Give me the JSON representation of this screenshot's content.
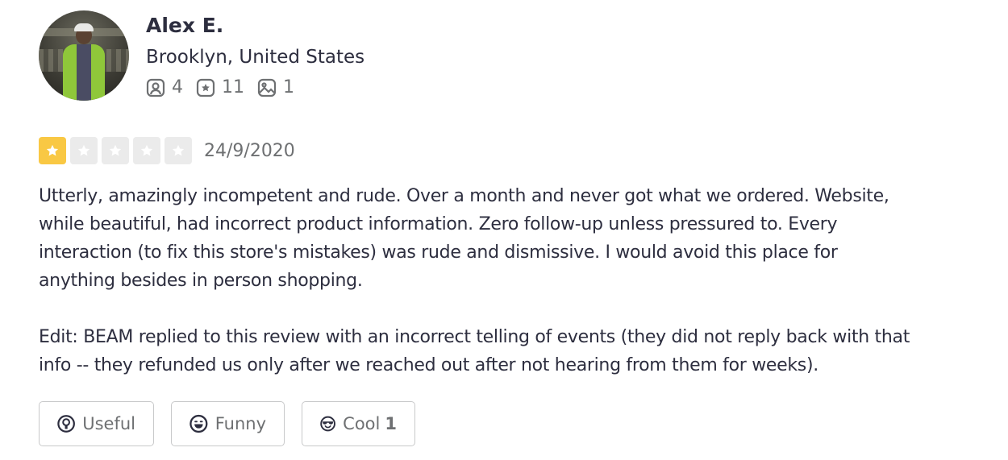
{
  "user": {
    "name": "Alex E.",
    "location": "Brooklyn, United States",
    "stats": [
      {
        "icon": "friends-icon",
        "value": "4"
      },
      {
        "icon": "reviews-star-icon",
        "value": "11"
      },
      {
        "icon": "photos-icon",
        "value": "1"
      }
    ]
  },
  "review": {
    "rating": 1,
    "max_rating": 5,
    "star_color_on": "#f9c844",
    "star_color_off": "#ebebeb",
    "date": "24/9/2020",
    "paragraphs": [
      "Utterly, amazingly incompetent and rude. Over a month and never got what we ordered. Website,\nwhile beautiful, had incorrect product information. Zero follow-up unless pressured to. Every\ninteraction (to fix this store's mistakes) was rude and dismissive. I would avoid this place for\nanything besides in person shopping.",
      "Edit: BEAM replied to this review with an incorrect telling of events (they did not reply back with that\ninfo -- they refunded us only after we reached out after not hearing from them for weeks)."
    ]
  },
  "actions": {
    "useful": {
      "label": "Useful",
      "count": ""
    },
    "funny": {
      "label": "Funny",
      "count": ""
    },
    "cool": {
      "label": "Cool",
      "count": "1"
    }
  }
}
